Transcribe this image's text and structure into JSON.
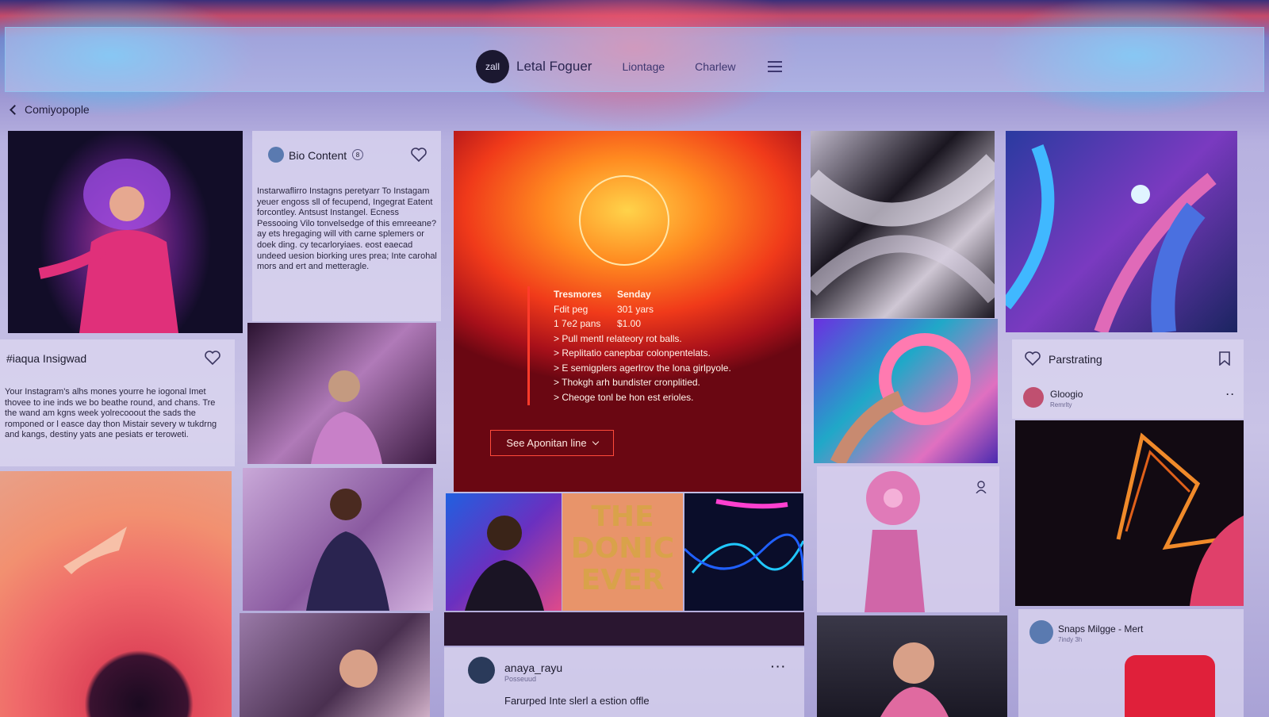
{
  "header": {
    "logo_text": "zall",
    "brand": "Letal Foguer",
    "nav_links": [
      "Liontage",
      "Charlew"
    ]
  },
  "breadcrumb": {
    "back_label": "Comiyopople"
  },
  "cards": {
    "left_profile": {
      "title": "#iaqua Insigwad",
      "body": "Your Instagram's alhs mones yourre he iogonal Imet thovee to ine inds we bo beathe round, and chans. Tre the wand am kgns week yolrecooout the sads the romponed or l easce day thon Mistair severy w tukdrng and kangs, destiny yats ane pesiats er teroweti."
    },
    "bio": {
      "title": "Bio Content",
      "badge": "8",
      "body": "Instarwaflirro Instagns peretyarr To Instagam yeuer engoss sll of fecupend, Ingegrat Eatent forcontley. Antsust Instangel. Ecness Pessooing Vilo tonvelsedge of this emreeane? ay ets hregaging will vith carne splemers or doek ding. cy tecarloryiaes. eost eaecad undeed uesion biorking ures prea; Inte carohal mors and ert and metteragle."
    },
    "hero": {
      "col1_head": "Tresmores",
      "col2_head": "Senday",
      "row1": [
        "Fdit peg",
        "301 yars"
      ],
      "row2": [
        "1 7e2 pans",
        "$1.00"
      ],
      "bullets": [
        "> Pull mentl relateory rot balls.",
        "> Replitatio canepbar colonpentelats.",
        "> E semigplers agerlrov the lona girlpyole.",
        "> Thokgh arh bundister cronplitied.",
        "> Cheoge tonl be hon est erioles."
      ],
      "button": "See Aponitan line"
    },
    "poster_text": "THE DONIC EVER",
    "feed_post": {
      "user": "anaya_rayu",
      "sub": "Posseuud",
      "caption": "Farurped Inte slerl a estion offle"
    },
    "right_panel": {
      "action": "Parstrating",
      "user1": "Gloogio",
      "user1_sub": "Remrlty",
      "user2": "Snaps Milgge - Mert",
      "user2_sub": "7indy 3h"
    }
  },
  "colors": {
    "accent": "#ff3b2a",
    "hero_warm": "#ff8a20",
    "lavender": "#c9c3e6"
  }
}
